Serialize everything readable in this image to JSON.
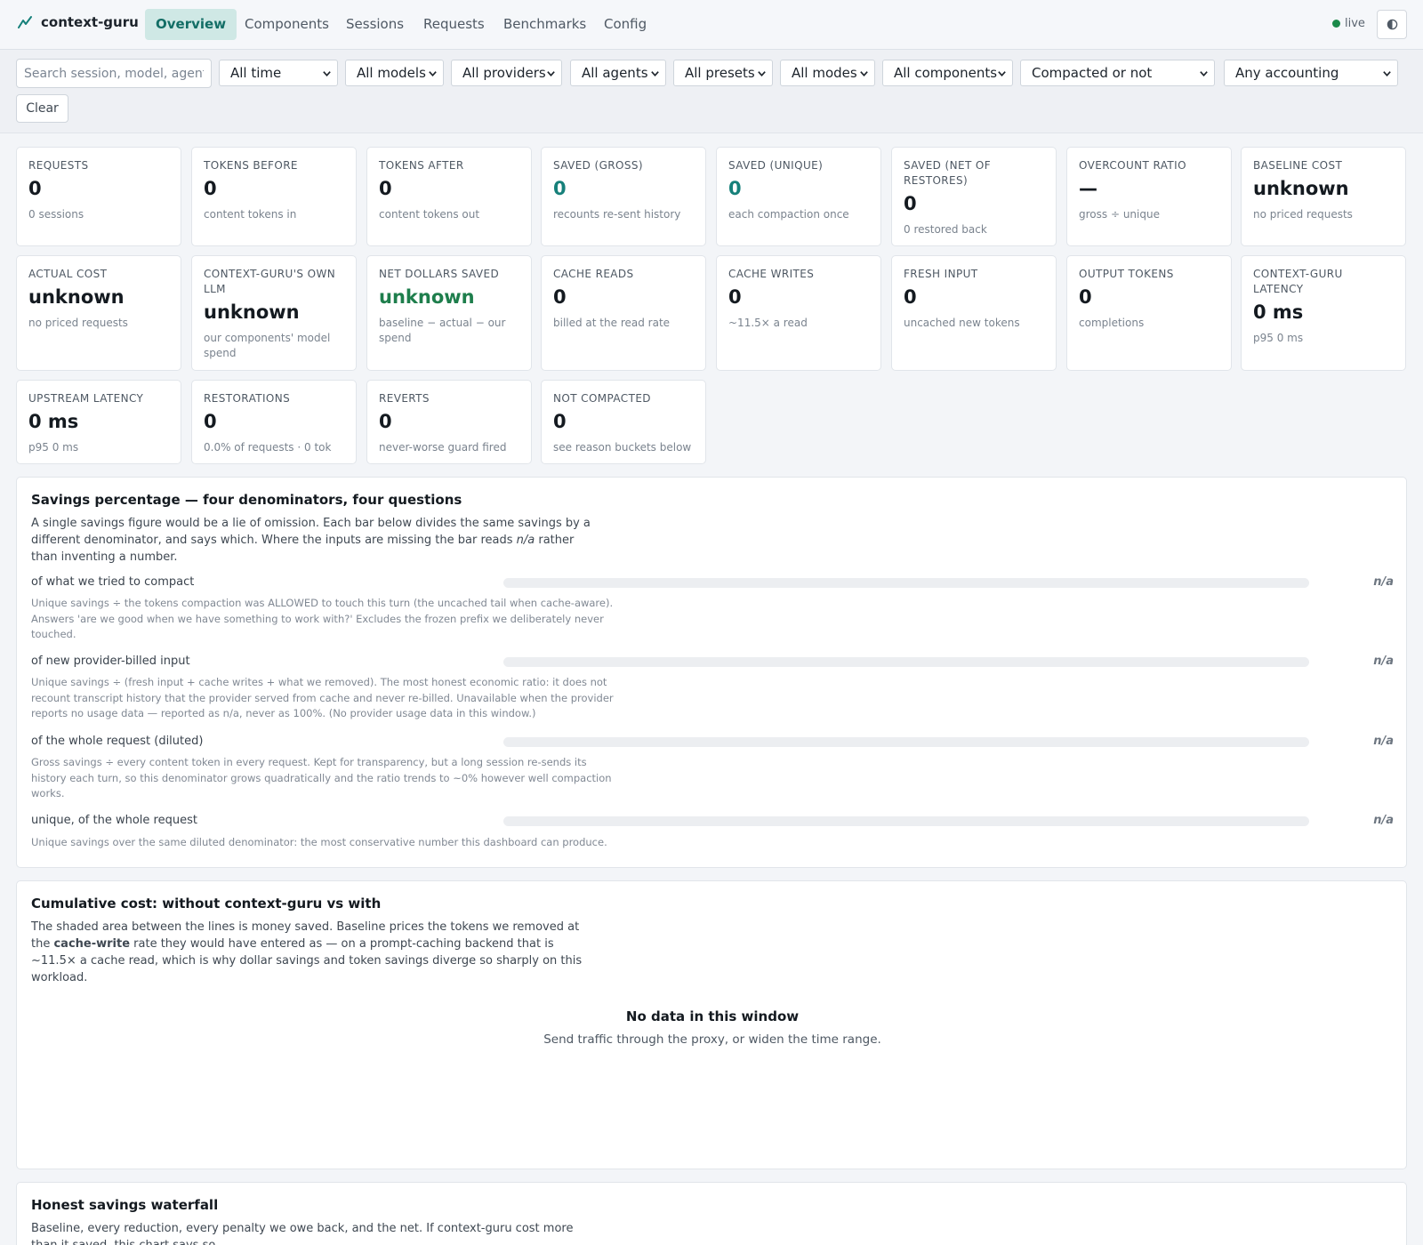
{
  "app": {
    "name": "context-guru",
    "live_label": "live"
  },
  "nav": {
    "tabs": [
      {
        "label": "Overview",
        "active": true
      },
      {
        "label": "Components"
      },
      {
        "label": "Sessions"
      },
      {
        "label": "Requests"
      },
      {
        "label": "Benchmarks"
      },
      {
        "label": "Config"
      }
    ]
  },
  "filters": {
    "search_placeholder": "Search session, model, agent",
    "selects": [
      "All time",
      "All models",
      "All providers",
      "All agents",
      "All presets",
      "All modes",
      "All components",
      "Compacted or not",
      "Any accounting"
    ],
    "clear_label": "Clear"
  },
  "stats": [
    {
      "label": "REQUESTS",
      "value": "0",
      "sub": "0 sessions"
    },
    {
      "label": "TOKENS BEFORE",
      "value": "0",
      "sub": "content tokens in"
    },
    {
      "label": "TOKENS AFTER",
      "value": "0",
      "sub": "content tokens out"
    },
    {
      "label": "SAVED (GROSS)",
      "value": "0",
      "sub": "recounts re-sent history",
      "tone": "teal"
    },
    {
      "label": "SAVED (UNIQUE)",
      "value": "0",
      "sub": "each compaction once",
      "tone": "teal"
    },
    {
      "label": "SAVED (NET OF RESTORES)",
      "value": "0",
      "sub": "0 restored back"
    },
    {
      "label": "OVERCOUNT RATIO",
      "value": "—",
      "sub": "gross ÷ unique"
    },
    {
      "label": "BASELINE COST",
      "value": "unknown",
      "sub": "no priced requests"
    },
    {
      "label": "ACTUAL COST",
      "value": "unknown",
      "sub": "no priced requests"
    },
    {
      "label": "CONTEXT-GURU'S OWN LLM",
      "value": "unknown",
      "sub": "our components' model spend"
    },
    {
      "label": "NET DOLLARS SAVED",
      "value": "unknown",
      "sub": "baseline − actual − our spend",
      "tone": "green"
    },
    {
      "label": "CACHE READS",
      "value": "0",
      "sub": "billed at the read rate"
    },
    {
      "label": "CACHE WRITES",
      "value": "0",
      "sub": "~11.5× a read"
    },
    {
      "label": "FRESH INPUT",
      "value": "0",
      "sub": "uncached new tokens"
    },
    {
      "label": "OUTPUT TOKENS",
      "value": "0",
      "sub": "completions"
    },
    {
      "label": "CONTEXT-GURU LATENCY",
      "value": "0 ms",
      "sub": "p95 0 ms"
    },
    {
      "label": "UPSTREAM LATENCY",
      "value": "0 ms",
      "sub": "p95 0 ms"
    },
    {
      "label": "RESTORATIONS",
      "value": "0",
      "sub": "0.0% of requests · 0 tok"
    },
    {
      "label": "REVERTS",
      "value": "0",
      "sub": "never-worse guard fired"
    },
    {
      "label": "NOT COMPACTED",
      "value": "0",
      "sub": "see reason buckets below"
    }
  ],
  "savings": {
    "title": "Savings percentage — four denominators, four questions",
    "desc_before": "A single savings figure would be a lie of omission. Each bar below divides the same savings by a different denominator, and says which. Where the inputs are missing the bar reads ",
    "desc_em": "n/a",
    "desc_after": " rather than inventing a number.",
    "bars": [
      {
        "label": "of what we tried to compact",
        "value": "n/a",
        "fraction": 0,
        "note": "Unique savings ÷ the tokens compaction was ALLOWED to touch this turn (the uncached tail when cache-aware). Answers 'are we good when we have something to work with?' Excludes the frozen prefix we deliberately never touched."
      },
      {
        "label": "of new provider-billed input",
        "value": "n/a",
        "fraction": 0,
        "note": "Unique savings ÷ (fresh input + cache writes + what we removed). The most honest economic ratio: it does not recount transcript history that the provider served from cache and never re-billed. Unavailable when the provider reports no usage data — reported as n/a, never as 100%. (No provider usage data in this window.)"
      },
      {
        "label": "of the whole request (diluted)",
        "value": "n/a",
        "fraction": 0,
        "note": "Gross savings ÷ every content token in every request. Kept for transparency, but a long session re-sends its history each turn, so this denominator grows quadratically and the ratio trends to ~0% however well compaction works."
      },
      {
        "label": "unique, of the whole request",
        "value": "n/a",
        "fraction": 0,
        "note": "Unique savings over the same diluted denominator: the most conservative number this dashboard can produce."
      }
    ]
  },
  "cumulative": {
    "title": "Cumulative cost: without context-guru vs with",
    "desc_before": "The shaded area between the lines is money saved. Baseline prices the tokens we removed at the ",
    "desc_strong": "cache-write",
    "desc_after": " rate they would have entered as — on a prompt-caching backend that is ~11.5× a cache read, which is why dollar savings and token savings diverge so sharply on this workload.",
    "empty_title": "No data in this window",
    "empty_sub": "Send traffic through the proxy, or widen the time range."
  },
  "waterfall": {
    "title": "Honest savings waterfall",
    "desc": "Baseline, every reduction, every penalty we owe back, and the net. If context-guru cost more than it saved, this chart says so."
  },
  "colors": {
    "accent": "#16807a",
    "positive": "#1e7e4c",
    "live": "#1b8a4a",
    "active_tab_bg": "#cfe8e5"
  }
}
